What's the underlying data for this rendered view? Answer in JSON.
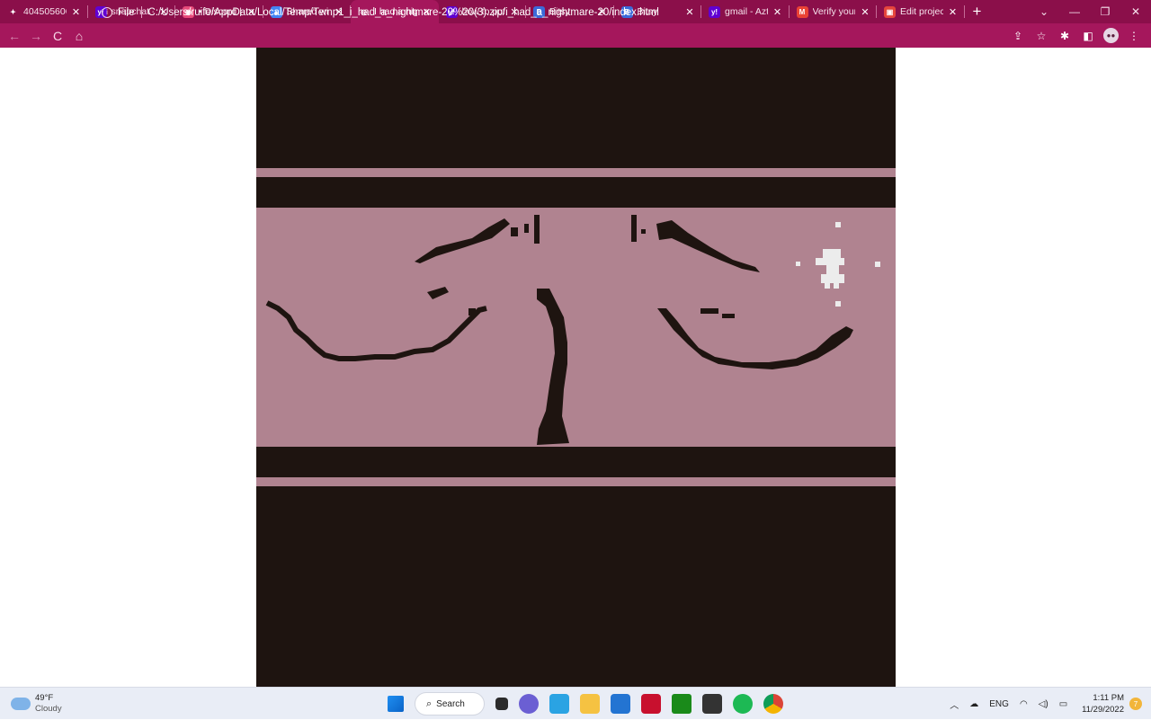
{
  "browser": {
    "tabs": [
      {
        "title": "404505606",
        "icon": "spark-icon",
        "color": "#ffffff",
        "glyph": "✦"
      },
      {
        "title": "snapchat - A",
        "icon": "yahoo-icon",
        "color": "#6001d2",
        "glyph": "y!"
      },
      {
        "title": "• Discord | #",
        "icon": "discord-icon",
        "color": "#e64a7a",
        "glyph": "◉"
      },
      {
        "title": "Shared with",
        "icon": "drive-icon",
        "color": "#4285f4",
        "glyph": "▲"
      },
      {
        "title": "I had a nigh",
        "icon": "globe-icon",
        "color": "#ffffff",
        "glyph": "◎",
        "active": true
      },
      {
        "title": "how to put i",
        "icon": "yahoo-icon",
        "color": "#6001d2",
        "glyph": "y!"
      },
      {
        "title": "Bitsy",
        "icon": "bitsy-icon",
        "color": "#3b6bd9",
        "glyph": "B"
      },
      {
        "title": "Bitsy",
        "icon": "bitsy-icon",
        "color": "#3b6bd9",
        "glyph": "B"
      },
      {
        "title": "gmail - Azte",
        "icon": "yahoo-icon",
        "color": "#6001d2",
        "glyph": "y!"
      },
      {
        "title": "Verify your e",
        "icon": "gmail-icon",
        "color": "#ea4335",
        "glyph": "M"
      },
      {
        "title": "Edit project",
        "icon": "project-icon",
        "color": "#e5453c",
        "glyph": "▣"
      }
    ],
    "new_tab": "+",
    "window_controls": [
      "⌄",
      "—",
      "❐",
      "✕"
    ],
    "address": {
      "scheme_label": "File",
      "url": "C:/Users/ruife/AppData/Local/Temp/Temp1_i_had_a_nightmare-20%20(3).zip/i_had_a_nightmare-20/index.html"
    },
    "nav": {
      "back": "←",
      "forward": "→",
      "reload": "C",
      "home": "⌂"
    },
    "right_icons": {
      "share": "⇪",
      "star": "☆",
      "extensions": "✱",
      "sidebar": "◧",
      "menu": "⋮"
    }
  },
  "game": {
    "colors": {
      "background": "#1e1410",
      "tile": "#b08390",
      "sprite": "#ececec"
    }
  },
  "taskbar": {
    "weather": {
      "temp": "49°F",
      "condition": "Cloudy"
    },
    "search_label": "Search",
    "language": "ENG",
    "time": "1:11 PM",
    "date": "11/29/2022",
    "notification_count": "7"
  }
}
